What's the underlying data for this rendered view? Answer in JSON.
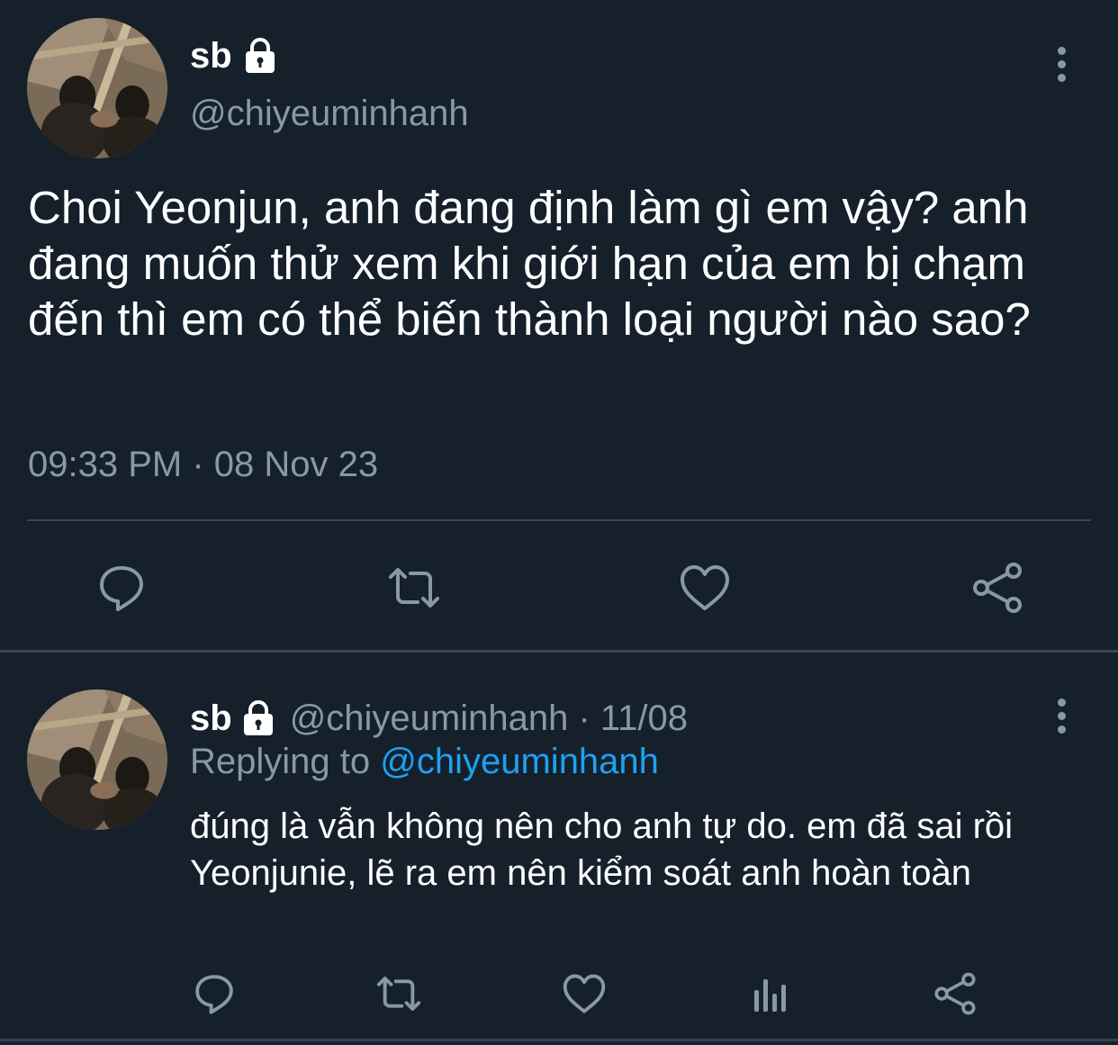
{
  "colors": {
    "background": "#15202b",
    "text": "#ffffff",
    "muted": "#8899a6",
    "link": "#1da1f2",
    "divider": "#38444d"
  },
  "main_tweet": {
    "display_name": "sb",
    "handle": "@chiyeuminhanh",
    "text": "Choi Yeonjun, anh đang định làm gì em vậy? anh đang muốn thử xem khi giới hạn của em bị chạm đến thì em có thể biến thành loại người nào sao?",
    "timestamp": "09:33 PM · 08 Nov 23",
    "icons": {
      "avatar": "profile-photo",
      "protected": "lock-icon",
      "more": "more-vertical-icon",
      "actions": [
        "reply-icon",
        "retweet-icon",
        "like-icon",
        "share-icon"
      ]
    }
  },
  "reply": {
    "display_name": "sb",
    "meta": "@chiyeuminhanh · 11/08",
    "replying_prefix": "Replying to",
    "replying_mention": "@chiyeuminhanh",
    "text": "đúng là vẫn không nên cho anh tự do. em đã sai rồi Yeonjunie, lẽ ra em nên kiểm soát anh hoàn toàn",
    "icons": {
      "avatar": "profile-photo",
      "protected": "lock-icon",
      "more": "more-vertical-icon",
      "actions": [
        "reply-icon",
        "retweet-icon",
        "like-icon",
        "analytics-icon",
        "share-icon"
      ]
    }
  }
}
